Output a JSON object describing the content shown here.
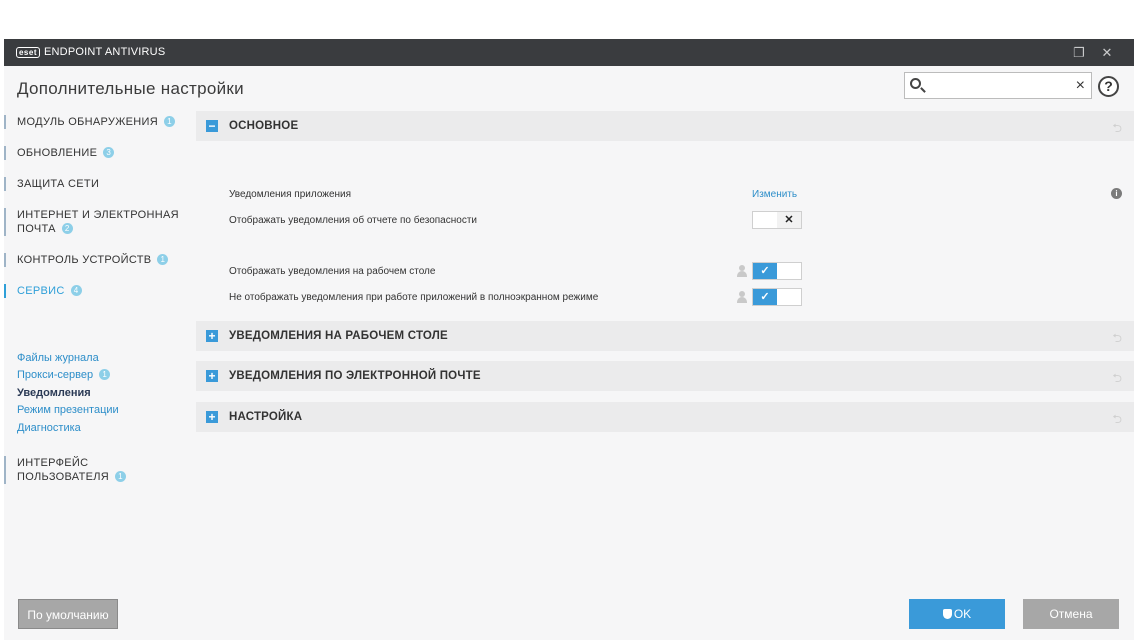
{
  "window": {
    "logo_text": "eset",
    "app_title": "ENDPOINT ANTIVIRUS",
    "restore_icon": "restore-icon",
    "close_icon": "close-icon"
  },
  "header": {
    "page_title": "Дополнительные настройки",
    "search_value": "",
    "clear_glyph": "×",
    "help_glyph": "?"
  },
  "sidebar": {
    "items": [
      {
        "label": "МОДУЛЬ ОБНАРУЖЕНИЯ",
        "badge": "1"
      },
      {
        "label": "ОБНОВЛЕНИЕ",
        "badge": "3"
      },
      {
        "label": "ЗАЩИТА СЕТИ",
        "badge": ""
      },
      {
        "label_line1": "ИНТЕРНЕТ И ЭЛЕКТРОННАЯ",
        "label_line2": "ПОЧТА",
        "badge": "2"
      },
      {
        "label": "КОНТРОЛЬ УСТРОЙСТВ",
        "badge": "1"
      },
      {
        "label": "СЕРВИС",
        "badge": "4"
      },
      {
        "label_line1": "ИНТЕРФЕЙС",
        "label_line2": "ПОЛЬЗОВАТЕЛЯ",
        "badge": "1"
      }
    ],
    "subitems": [
      {
        "label": "Файлы журнала",
        "badge": ""
      },
      {
        "label": "Прокси-сервер",
        "badge": "1"
      },
      {
        "label": "Уведомления",
        "badge": ""
      },
      {
        "label": "Режим презентации",
        "badge": ""
      },
      {
        "label": "Диагностика",
        "badge": ""
      }
    ]
  },
  "main": {
    "sections": [
      {
        "label": "ОСНОВНОЕ",
        "toggle": "−",
        "expanded": true
      },
      {
        "label": "УВЕДОМЛЕНИЯ НА РАБОЧЕМ СТОЛЕ",
        "toggle": "+",
        "expanded": false
      },
      {
        "label": "УВЕДОМЛЕНИЯ ПО ЭЛЕКТРОННОЙ ПОЧТЕ",
        "toggle": "+",
        "expanded": false
      },
      {
        "label": "НАСТРОЙКА",
        "toggle": "+",
        "expanded": false
      }
    ],
    "revert_glyph": "⮌",
    "rows": [
      {
        "label": "Уведомления приложения",
        "link": "Изменить",
        "info": "i"
      },
      {
        "label": "Отображать уведомления об отчете по безопасности",
        "switch": "off",
        "glyph": "✕"
      },
      {
        "label": "Отображать уведомления на рабочем столе",
        "switch": "on",
        "glyph": "✓"
      },
      {
        "label": "Не отображать уведомления при работе приложений в полноэкранном режиме",
        "switch": "on",
        "glyph": "✓"
      }
    ]
  },
  "footer": {
    "default_label": "По умолчанию",
    "ok_label": "OK",
    "cancel_label": "Отмена"
  },
  "colors": {
    "accent": "#3a9ad9",
    "titlebar": "#3a3c3f",
    "link": "#2d8ec9"
  }
}
